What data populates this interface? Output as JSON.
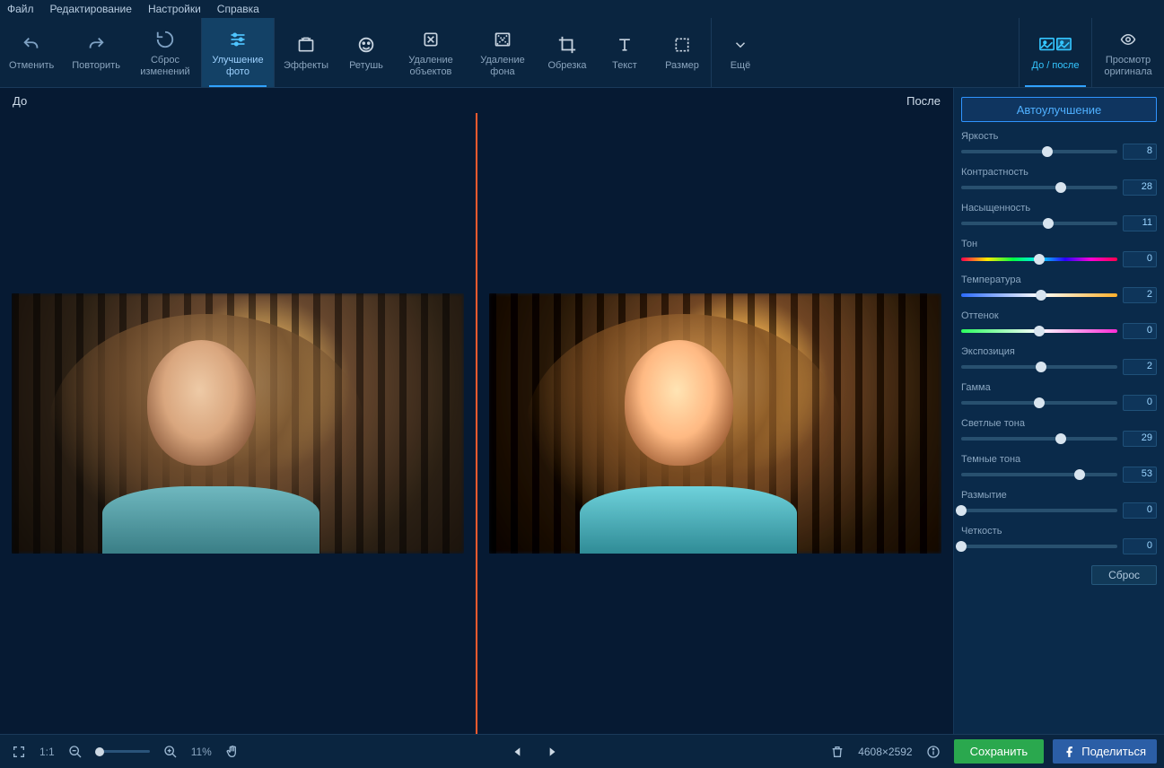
{
  "menubar": {
    "items": [
      "Файл",
      "Редактирование",
      "Настройки",
      "Справка"
    ]
  },
  "toolbar": {
    "undo": "Отменить",
    "redo": "Повторить",
    "reset": "Сброс\nизменений",
    "enhance": "Улучшение\nфото",
    "effects": "Эффекты",
    "retouch": "Ретушь",
    "remove_obj": "Удаление\nобъектов",
    "remove_bg": "Удаление\nфона",
    "crop": "Обрезка",
    "text": "Текст",
    "resize": "Размер",
    "more": "Ещё",
    "before_after": "До / после",
    "view_orig": "Просмотр\nоригинала"
  },
  "canvas": {
    "before": "До",
    "after": "После"
  },
  "panel": {
    "auto": "Автоулучшение",
    "reset": "Сброс",
    "sliders": [
      {
        "label": "Яркость",
        "value": 8,
        "pos": 55,
        "kind": "plain"
      },
      {
        "label": "Контрастность",
        "value": 28,
        "pos": 64,
        "kind": "plain"
      },
      {
        "label": "Насыщенность",
        "value": 11,
        "pos": 56,
        "kind": "plain"
      },
      {
        "label": "Тон",
        "value": 0,
        "pos": 50,
        "kind": "hue"
      },
      {
        "label": "Температура",
        "value": 2,
        "pos": 51,
        "kind": "temp"
      },
      {
        "label": "Оттенок",
        "value": 0,
        "pos": 50,
        "kind": "tint"
      },
      {
        "label": "Экспозиция",
        "value": 2,
        "pos": 51,
        "kind": "plain"
      },
      {
        "label": "Гамма",
        "value": 0,
        "pos": 50,
        "kind": "plain"
      },
      {
        "label": "Светлые тона",
        "value": 29,
        "pos": 64,
        "kind": "plain"
      },
      {
        "label": "Темные тона",
        "value": 53,
        "pos": 76,
        "kind": "plain"
      },
      {
        "label": "Размытие",
        "value": 0,
        "pos": 0,
        "kind": "plain"
      },
      {
        "label": "Четкость",
        "value": 0,
        "pos": 0,
        "kind": "plain"
      }
    ]
  },
  "bottom": {
    "fit": "1:1",
    "zoom": "11%",
    "dimensions": "4608×2592",
    "save": "Сохранить",
    "share": "Поделиться"
  }
}
